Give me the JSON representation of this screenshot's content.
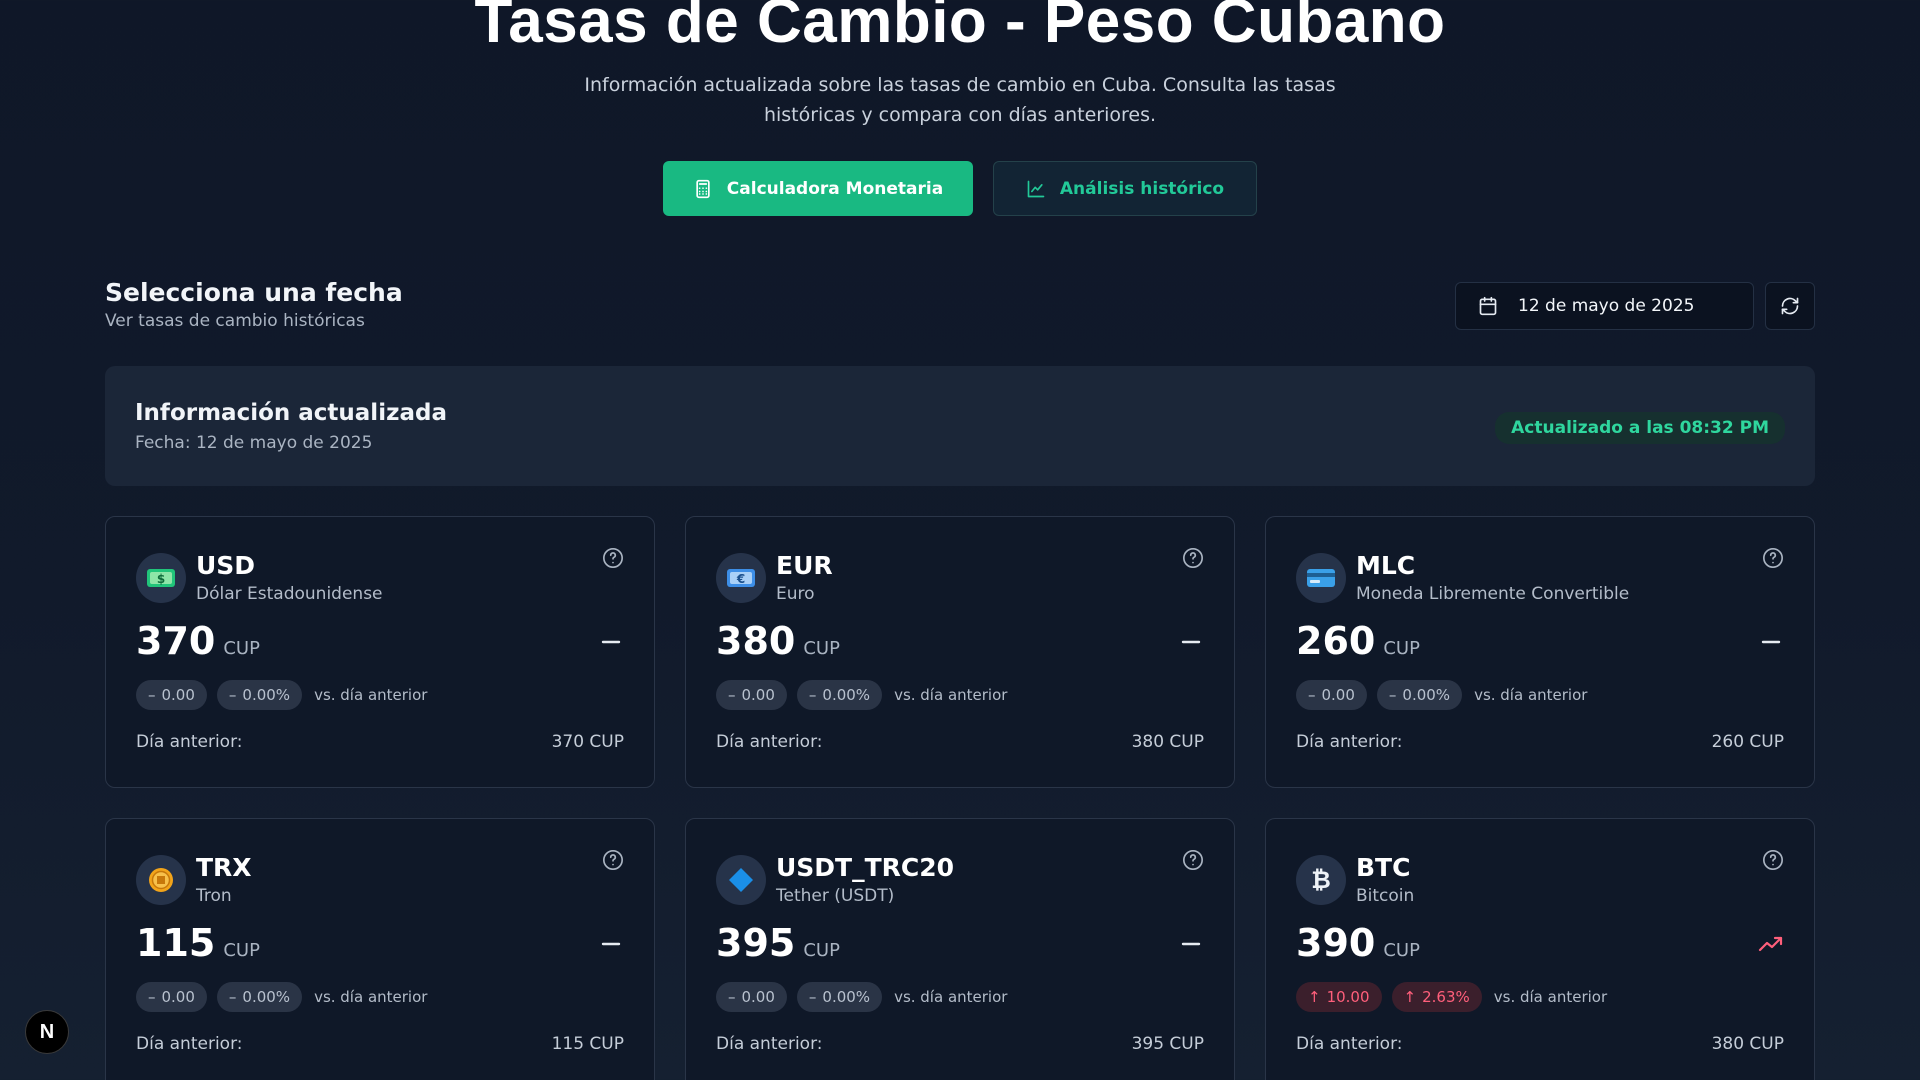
{
  "header": {
    "title": "Tasas de Cambio - Peso Cubano",
    "subtitle": "Información actualizada sobre las tasas de cambio en Cuba. Consulta las tasas históricas y compara con días anteriores."
  },
  "actions": {
    "calculator_label": "Calculadora Monetaria",
    "history_label": "Análisis histórico"
  },
  "date_section": {
    "title": "Selecciona una fecha",
    "subtitle": "Ver tasas de cambio históricas",
    "selected_date": "12 de mayo de 2025"
  },
  "info": {
    "title": "Información actualizada",
    "date_line": "Fecha: 12 de mayo de 2025",
    "updated": "Actualizado a las 08:32 PM"
  },
  "labels": {
    "vs": "vs. día anterior",
    "prev": "Día anterior:"
  },
  "colors": {
    "accent": "#19b982",
    "up": "#ff5f7b",
    "neutral": "#b8c1ce"
  },
  "currencies": [
    {
      "code": "USD",
      "name": "Dólar Estadounidense",
      "value": "370",
      "unit": "CUP",
      "change": "0.00",
      "change_pct": "0.00%",
      "prev": "370 CUP",
      "icon": "banknote-icon",
      "trend": "neutral"
    },
    {
      "code": "EUR",
      "name": "Euro",
      "value": "380",
      "unit": "CUP",
      "change": "0.00",
      "change_pct": "0.00%",
      "prev": "380 CUP",
      "icon": "euro-banknote-icon",
      "trend": "neutral"
    },
    {
      "code": "MLC",
      "name": "Moneda Libremente Convertible",
      "value": "260",
      "unit": "CUP",
      "change": "0.00",
      "change_pct": "0.00%",
      "prev": "260 CUP",
      "icon": "credit-card-icon",
      "trend": "neutral"
    },
    {
      "code": "TRX",
      "name": "Tron",
      "value": "115",
      "unit": "CUP",
      "change": "0.00",
      "change_pct": "0.00%",
      "prev": "115 CUP",
      "icon": "coin-icon",
      "trend": "neutral"
    },
    {
      "code": "USDT_TRC20",
      "name": "Tether (USDT)",
      "value": "395",
      "unit": "CUP",
      "change": "0.00",
      "change_pct": "0.00%",
      "prev": "395 CUP",
      "icon": "diamond-icon",
      "trend": "neutral"
    },
    {
      "code": "BTC",
      "name": "Bitcoin",
      "value": "390",
      "unit": "CUP",
      "change": "10.00",
      "change_pct": "2.63%",
      "prev": "380 CUP",
      "icon": "bitcoin-icon",
      "trend": "up"
    }
  ],
  "dev_badge": "N"
}
